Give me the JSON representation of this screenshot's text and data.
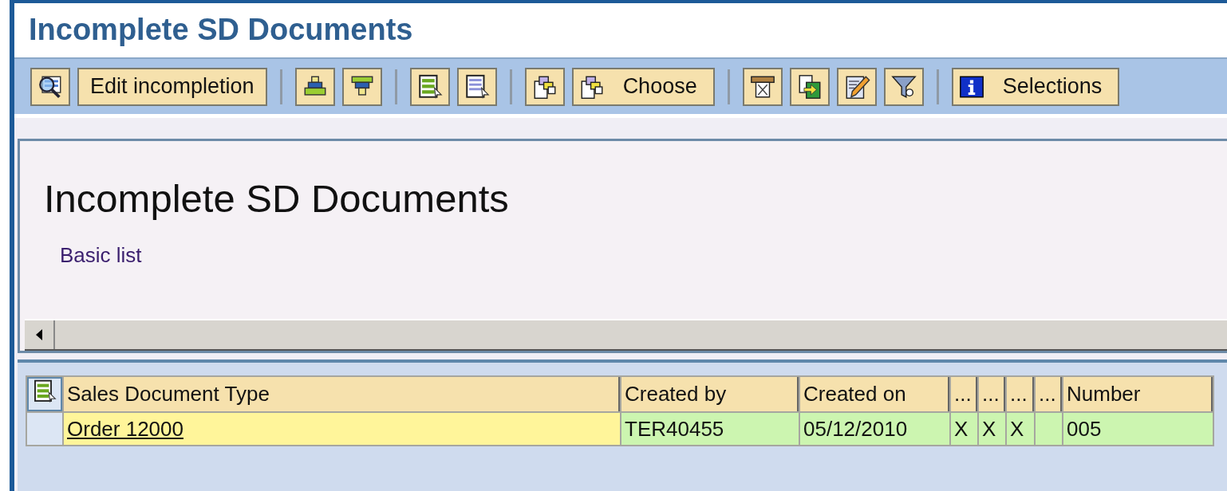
{
  "window": {
    "title": "Incomplete SD Documents"
  },
  "toolbar": [
    {
      "kind": "icon_button"
    },
    {
      "kind": "button",
      "label": "Edit incompletion"
    },
    {
      "kind": "separator"
    },
    {
      "kind": "icon_button"
    },
    {
      "kind": "icon_button"
    },
    {
      "kind": "separator"
    },
    {
      "kind": "icon_button"
    },
    {
      "kind": "icon_button"
    },
    {
      "kind": "separator"
    },
    {
      "kind": "icon_button"
    },
    {
      "kind": "icon_label_button",
      "label": "Choose"
    },
    {
      "kind": "separator"
    },
    {
      "kind": "icon_button"
    },
    {
      "kind": "icon_button"
    },
    {
      "kind": "icon_button"
    },
    {
      "kind": "icon_button"
    },
    {
      "kind": "separator"
    },
    {
      "kind": "icon_label_button",
      "label": "Selections"
    }
  ],
  "header": {
    "title": "Incomplete SD Documents",
    "subtitle": "Basic list"
  },
  "table": {
    "columns": [
      {
        "label": "Sales Document Type",
        "kind": "key"
      },
      {
        "label": "Created by",
        "kind": "field"
      },
      {
        "label": "Created on",
        "kind": "field"
      },
      {
        "label": "...",
        "kind": "field"
      },
      {
        "label": "...",
        "kind": "field"
      },
      {
        "label": "...",
        "kind": "field"
      },
      {
        "label": "...",
        "kind": "field"
      },
      {
        "label": "Number",
        "kind": "field"
      }
    ],
    "rows": [
      {
        "selected": false,
        "cells": [
          "Order 12000",
          "TER40455",
          "05/12/2010",
          "X",
          "X",
          "X",
          "",
          "005"
        ]
      }
    ]
  }
}
